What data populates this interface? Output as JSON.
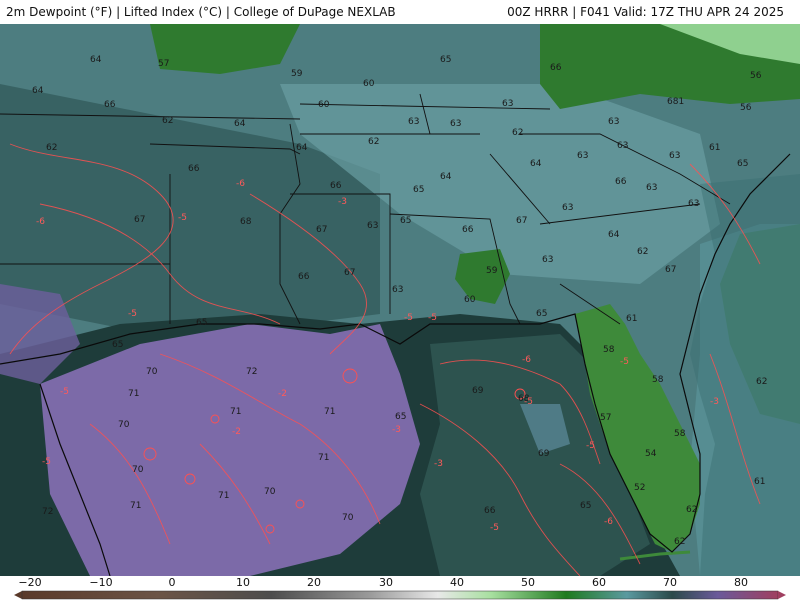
{
  "header": {
    "left_title": "2m Dewpoint (°F) | Lifted Index (°C) | College of DuPage NEXLAB",
    "right_title": "00Z HRRR | F041 Valid: 17Z THU APR 24 2025"
  },
  "colorbar": {
    "ticks": [
      "−20",
      "−10",
      "0",
      "10",
      "20",
      "30",
      "40",
      "50",
      "60",
      "70",
      "80"
    ]
  },
  "dewpoint_labels": [
    {
      "t": "64"
    },
    {
      "t": "64"
    },
    {
      "t": "66"
    },
    {
      "t": "62"
    },
    {
      "t": "62"
    },
    {
      "t": "64"
    },
    {
      "t": "64"
    },
    {
      "t": "57"
    },
    {
      "t": "59"
    },
    {
      "t": "60"
    },
    {
      "t": "60"
    },
    {
      "t": "65"
    },
    {
      "t": "66"
    },
    {
      "t": "56"
    },
    {
      "t": "63"
    },
    {
      "t": "63"
    },
    {
      "t": "63"
    },
    {
      "t": "62"
    },
    {
      "t": "62"
    },
    {
      "t": "63"
    },
    {
      "t": "681"
    },
    {
      "t": "56"
    },
    {
      "t": "64"
    },
    {
      "t": "63"
    },
    {
      "t": "63"
    },
    {
      "t": "63"
    },
    {
      "t": "61"
    },
    {
      "t": "65"
    },
    {
      "t": "66"
    },
    {
      "t": "66"
    },
    {
      "t": "65"
    },
    {
      "t": "64"
    },
    {
      "t": "66"
    },
    {
      "t": "63"
    },
    {
      "t": "63"
    },
    {
      "t": "63"
    },
    {
      "t": "67"
    },
    {
      "t": "68"
    },
    {
      "t": "67"
    },
    {
      "t": "63"
    },
    {
      "t": "65"
    },
    {
      "t": "66"
    },
    {
      "t": "67"
    },
    {
      "t": "64"
    },
    {
      "t": "62"
    },
    {
      "t": "63"
    },
    {
      "t": "59"
    },
    {
      "t": "66"
    },
    {
      "t": "67"
    },
    {
      "t": "63"
    },
    {
      "t": "60"
    },
    {
      "t": "67"
    },
    {
      "t": "65"
    },
    {
      "t": "65"
    },
    {
      "t": "65"
    },
    {
      "t": "61"
    },
    {
      "t": "58"
    },
    {
      "t": "58"
    },
    {
      "t": "72"
    },
    {
      "t": "70"
    },
    {
      "t": "71"
    },
    {
      "t": "71"
    },
    {
      "t": "71"
    },
    {
      "t": "71"
    },
    {
      "t": "70"
    },
    {
      "t": "70"
    },
    {
      "t": "71"
    },
    {
      "t": "70"
    },
    {
      "t": "71"
    },
    {
      "t": "69"
    },
    {
      "t": "68"
    },
    {
      "t": "69"
    },
    {
      "t": "65"
    },
    {
      "t": "66"
    },
    {
      "t": "65"
    },
    {
      "t": "57"
    },
    {
      "t": "58"
    },
    {
      "t": "54"
    },
    {
      "t": "52"
    },
    {
      "t": "62"
    },
    {
      "t": "62"
    },
    {
      "t": "61"
    },
    {
      "t": "62"
    },
    {
      "t": "70"
    },
    {
      "t": "72"
    }
  ],
  "lifted_index_labels": [
    {
      "t": "-6"
    },
    {
      "t": "-5"
    },
    {
      "t": "-6"
    },
    {
      "t": "-5"
    },
    {
      "t": "-3"
    },
    {
      "t": "-5"
    },
    {
      "t": "-5"
    },
    {
      "t": "-2"
    },
    {
      "t": "-6"
    },
    {
      "t": "-5"
    },
    {
      "t": "-3"
    },
    {
      "t": "-3"
    },
    {
      "t": "-5"
    },
    {
      "t": "-5"
    },
    {
      "t": "-6"
    },
    {
      "t": "-5"
    },
    {
      "t": "-5"
    },
    {
      "t": "-3"
    },
    {
      "t": "-2"
    },
    {
      "t": "-5"
    }
  ]
}
